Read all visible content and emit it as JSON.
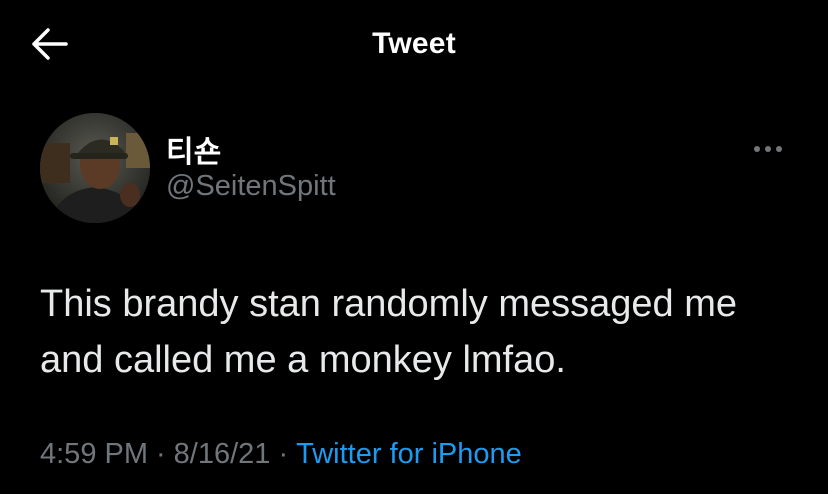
{
  "header": {
    "title": "Tweet",
    "back_icon": "arrow-left-icon"
  },
  "author": {
    "display_name": "티숀",
    "handle": "@SeitenSpitt",
    "avatar": "profile-photo"
  },
  "tweet": {
    "text": "This brandy stan randomly messaged me and called me a monkey lmfao.",
    "time": "4:59 PM",
    "date": "8/16/21",
    "separator": "·",
    "source": "Twitter for iPhone"
  },
  "more_icon": "more-options-icon",
  "colors": {
    "background": "#000000",
    "text": "#e7e9ea",
    "secondary": "#71767b",
    "accent": "#1d9bf0"
  }
}
